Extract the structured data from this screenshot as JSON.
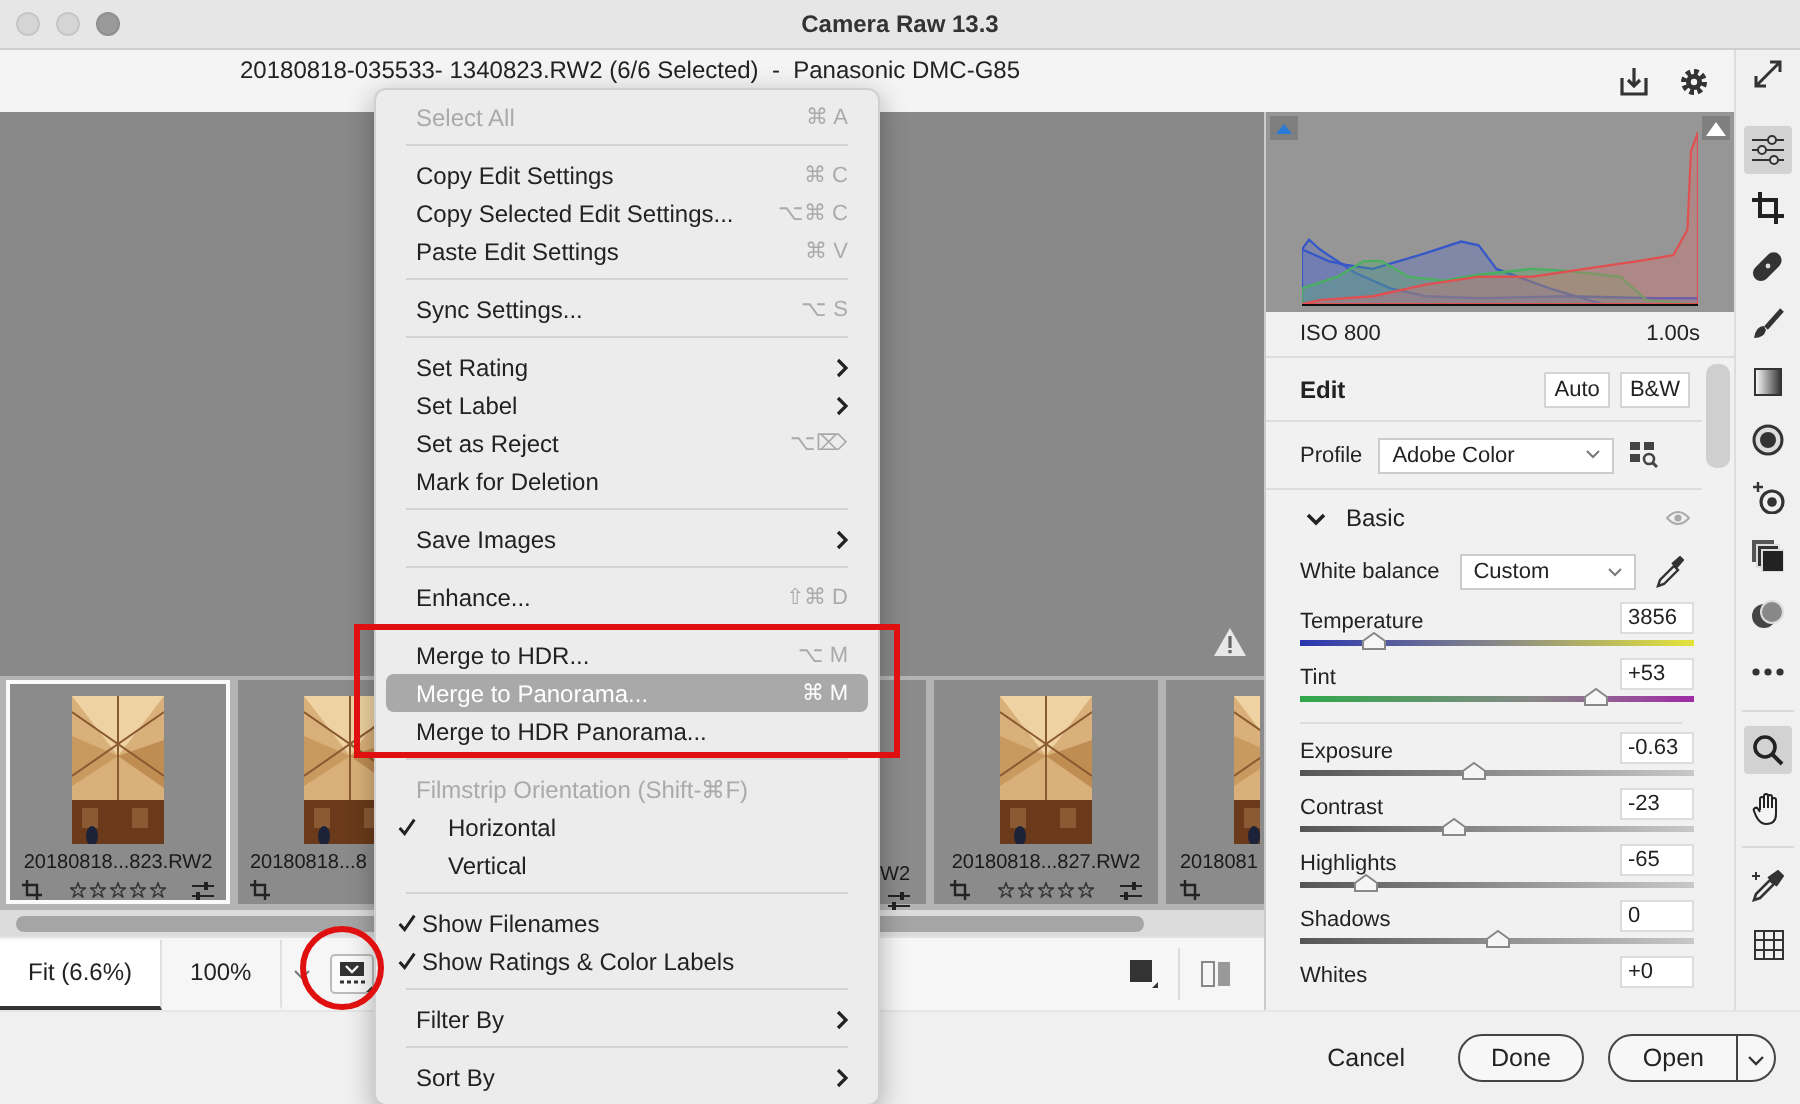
{
  "window": {
    "title": "Camera Raw 13.3"
  },
  "header": {
    "file_title": "20180818-035533- 1340823.RW2 (6/6 Selected)  -  Panasonic DMC-G85"
  },
  "menu": {
    "items": [
      {
        "kind": "item",
        "label": "Select All",
        "shortcut": "⌘ A",
        "submenu": false,
        "disabled": true,
        "selected": false
      },
      {
        "kind": "separator"
      },
      {
        "kind": "item",
        "label": "Copy Edit Settings",
        "shortcut": "⌘ C",
        "submenu": false,
        "disabled": false,
        "selected": false
      },
      {
        "kind": "item",
        "label": "Copy Selected Edit Settings...",
        "shortcut": "⌥⌘ C",
        "submenu": false,
        "disabled": false,
        "selected": false
      },
      {
        "kind": "item",
        "label": "Paste Edit Settings",
        "shortcut": "⌘ V",
        "submenu": false,
        "disabled": false,
        "selected": false
      },
      {
        "kind": "separator"
      },
      {
        "kind": "item",
        "label": "Sync Settings...",
        "shortcut": "⌥ S",
        "submenu": false,
        "disabled": false,
        "selected": false
      },
      {
        "kind": "separator"
      },
      {
        "kind": "item",
        "label": "Set Rating",
        "submenu": true,
        "disabled": false,
        "selected": false
      },
      {
        "kind": "item",
        "label": "Set Label",
        "submenu": true,
        "disabled": false,
        "selected": false
      },
      {
        "kind": "item",
        "label": "Set as Reject",
        "shortcut": "⌥⌦",
        "submenu": false,
        "disabled": false,
        "selected": false
      },
      {
        "kind": "item",
        "label": "Mark for Deletion",
        "submenu": false,
        "disabled": false,
        "selected": false
      },
      {
        "kind": "separator"
      },
      {
        "kind": "item",
        "label": "Save Images",
        "submenu": true,
        "disabled": false,
        "selected": false
      },
      {
        "kind": "separator"
      },
      {
        "kind": "item",
        "label": "Enhance...",
        "shortcut": "⇧⌘ D",
        "submenu": false,
        "disabled": false,
        "selected": false
      },
      {
        "kind": "separator"
      },
      {
        "kind": "item",
        "label": "Merge to HDR...",
        "shortcut": "⌥ M",
        "submenu": false,
        "disabled": false,
        "selected": false
      },
      {
        "kind": "item",
        "label": "Merge to Panorama...",
        "shortcut": "⌘ M",
        "submenu": false,
        "disabled": false,
        "selected": true
      },
      {
        "kind": "item",
        "label": "Merge to HDR Panorama...",
        "submenu": false,
        "disabled": false,
        "selected": false
      },
      {
        "kind": "separator"
      },
      {
        "kind": "item",
        "label": "Filmstrip Orientation (Shift-⌘F)",
        "submenu": false,
        "disabled": true,
        "selected": false
      },
      {
        "kind": "radio",
        "label": "Horizontal",
        "checked": true
      },
      {
        "kind": "radio",
        "label": "Vertical",
        "checked": false
      },
      {
        "kind": "separator"
      },
      {
        "kind": "toggle",
        "label": "Show Filenames",
        "checked": true
      },
      {
        "kind": "toggle",
        "label": "Show Ratings & Color Labels",
        "checked": true
      },
      {
        "kind": "separator"
      },
      {
        "kind": "item",
        "label": "Filter By",
        "submenu": true,
        "disabled": false,
        "selected": false
      },
      {
        "kind": "separator"
      },
      {
        "kind": "item",
        "label": "Sort By",
        "submenu": true,
        "disabled": false,
        "selected": false
      }
    ]
  },
  "filmstrip": {
    "thumbnails": [
      {
        "kind": "full",
        "filename": "20180818...823.RW2",
        "stars": 0,
        "selected": true
      },
      {
        "kind": "left_part",
        "filename": "20180818...8",
        "selected": false
      },
      {
        "kind": "right_part",
        "filename": "W2",
        "selected": false
      },
      {
        "kind": "full",
        "filename": "20180818...827.RW2",
        "stars": 0,
        "selected": false
      },
      {
        "kind": "left_part",
        "filename": "2018081",
        "selected": false
      }
    ]
  },
  "toolbar": {
    "zoom_tabs": [
      {
        "label": "Fit (6.6%)",
        "selected": true
      },
      {
        "label": "100%",
        "selected": false
      }
    ]
  },
  "panel": {
    "iso": "ISO 800",
    "shutter": "1.00s",
    "edit": {
      "title": "Edit",
      "buttons": [
        "Auto",
        "B&W"
      ]
    },
    "profile": {
      "label": "Profile",
      "value": "Adobe Color"
    },
    "basic": {
      "title": "Basic",
      "expanded": true
    },
    "white_balance": {
      "label": "White balance",
      "value": "Custom"
    },
    "white_balance_sliders": [
      {
        "kind": "temperature",
        "label": "Temperature",
        "value": "3856",
        "level": 0.19
      },
      {
        "kind": "tint",
        "label": "Tint",
        "value": "+53",
        "level": 0.75
      }
    ],
    "tone_sliders": [
      {
        "label": "Exposure",
        "value": "-0.63",
        "level": 0.44
      },
      {
        "label": "Contrast",
        "value": "-23",
        "level": 0.39
      },
      {
        "label": "Highlights",
        "value": "-65",
        "level": 0.17
      },
      {
        "label": "Shadows",
        "value": "0",
        "level": 0.5
      },
      {
        "label": "Whites",
        "value": "+0"
      }
    ]
  },
  "tools": [
    {
      "kind": "edit",
      "selected": true
    },
    {
      "kind": "crop",
      "selected": false
    },
    {
      "kind": "heal",
      "selected": false
    },
    {
      "kind": "brush",
      "selected": false
    },
    {
      "kind": "gradient",
      "selected": false
    },
    {
      "kind": "radial",
      "selected": false
    },
    {
      "kind": "redeye",
      "selected": false
    },
    {
      "kind": "snapshots",
      "selected": false
    },
    {
      "kind": "presets",
      "selected": false
    },
    {
      "kind": "more",
      "selected": false
    },
    {
      "kind": "divider"
    },
    {
      "kind": "zoom",
      "selected": true
    },
    {
      "kind": "hand",
      "selected": false
    },
    {
      "kind": "divider"
    },
    {
      "kind": "sampler",
      "selected": false
    },
    {
      "kind": "grid",
      "selected": false
    }
  ],
  "footer": {
    "buttons": [
      {
        "kind": "text",
        "label": "Cancel"
      },
      {
        "kind": "pill",
        "label": "Done"
      },
      {
        "kind": "split",
        "label": "Open"
      }
    ]
  }
}
